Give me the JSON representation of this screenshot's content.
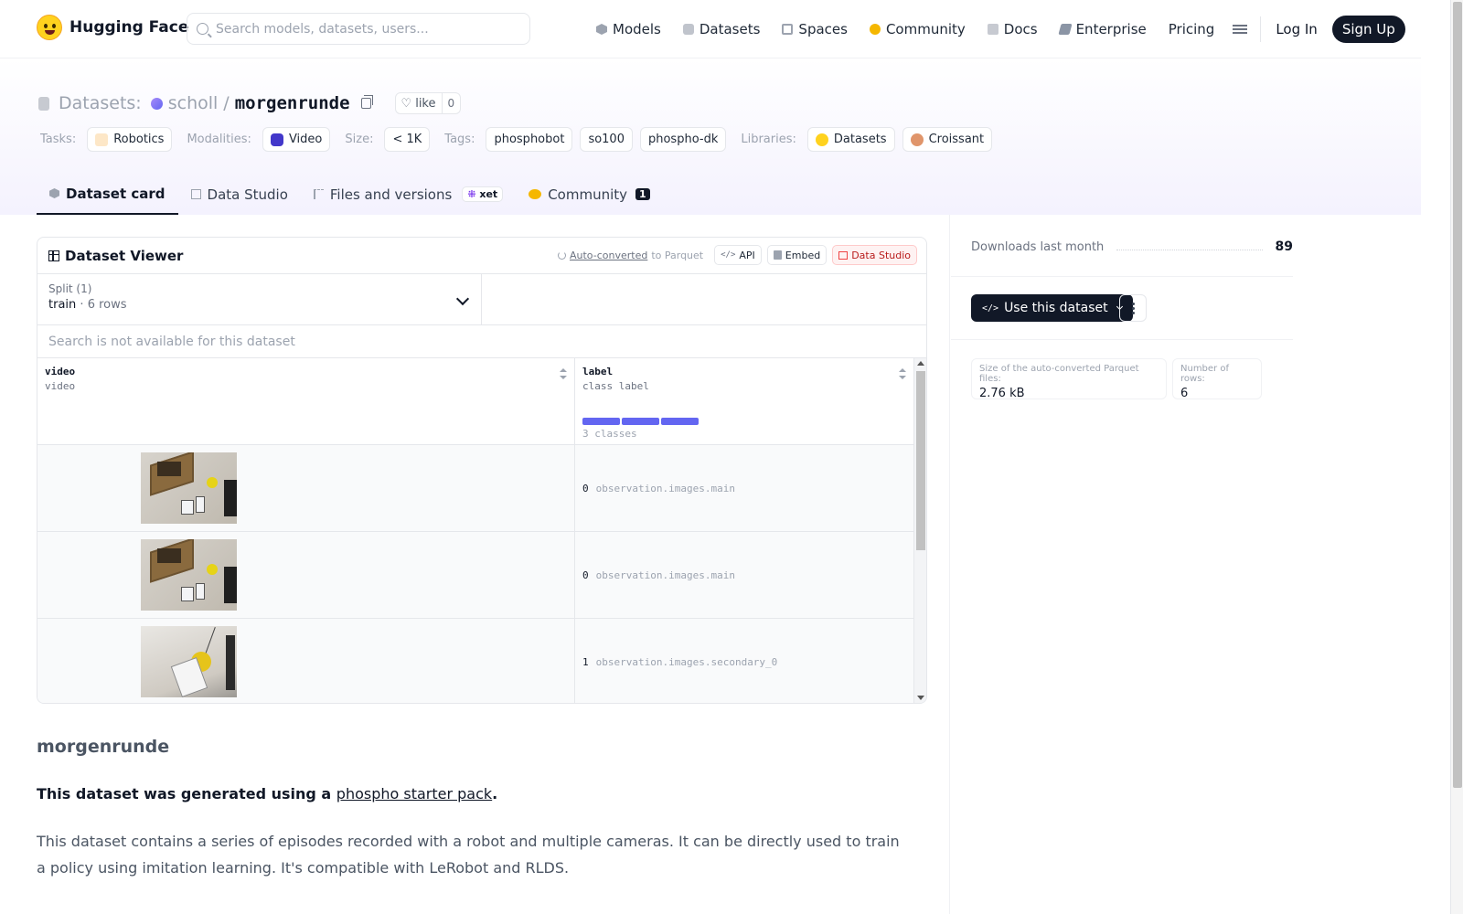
{
  "brand": {
    "name": "Hugging Face"
  },
  "search": {
    "placeholder": "Search models, datasets, users..."
  },
  "nav": {
    "items": [
      {
        "label": "Models",
        "icon": "models-icon"
      },
      {
        "label": "Datasets",
        "icon": "datasets-icon"
      },
      {
        "label": "Spaces",
        "icon": "spaces-icon"
      },
      {
        "label": "Community",
        "icon": "community-icon"
      },
      {
        "label": "Docs",
        "icon": "docs-icon"
      },
      {
        "label": "Enterprise",
        "icon": "enterprise-icon"
      },
      {
        "label": "Pricing",
        "icon": ""
      }
    ],
    "login": "Log In",
    "signup": "Sign Up"
  },
  "repo": {
    "type_label": "Datasets:",
    "owner": "scholl",
    "separator": "/",
    "name": "morgenrunde",
    "like_label": "like",
    "like_count": "0"
  },
  "tags": {
    "tasks_label": "Tasks:",
    "tasks": [
      "Robotics"
    ],
    "modalities_label": "Modalities:",
    "modalities": [
      "Video"
    ],
    "size_label": "Size:",
    "size": [
      "< 1K"
    ],
    "tags_label": "Tags:",
    "tags": [
      "phosphobot",
      "so100",
      "phospho-dk"
    ],
    "libraries_label": "Libraries:",
    "libraries": [
      "Datasets",
      "Croissant"
    ]
  },
  "tabs": [
    {
      "label": "Dataset card",
      "active": true
    },
    {
      "label": "Data Studio",
      "active": false
    },
    {
      "label": "Files and versions",
      "active": false,
      "badge": "xet"
    },
    {
      "label": "Community",
      "active": false,
      "count": "1"
    }
  ],
  "viewer": {
    "title": "Dataset Viewer",
    "autoconverted_prefix": "Auto-converted",
    "autoconverted_suffix": "to Parquet",
    "api_label": "API",
    "embed_label": "Embed",
    "studio_label": "Data Studio",
    "split_label": "Split (1)",
    "split_value": "train",
    "split_dot": "·",
    "split_rows": "6 rows",
    "search_na": "Search is not available for this dataset",
    "columns": [
      {
        "name": "video",
        "type": "video"
      },
      {
        "name": "label",
        "type": "class label",
        "classes_text": "3 classes"
      }
    ],
    "rows": [
      {
        "label_num": "0",
        "label_class": "observation.images.main"
      },
      {
        "label_num": "0",
        "label_class": "observation.images.main"
      },
      {
        "label_num": "1",
        "label_class": "observation.images.secondary_0"
      }
    ]
  },
  "card": {
    "heading": "morgenrunde",
    "p1_prefix": "This dataset was generated using a ",
    "p1_link": "phospho starter pack",
    "p1_suffix": ".",
    "p2": "This dataset contains a series of episodes recorded with a robot and multiple cameras. It can be directly used to train a policy using imitation learning. It's compatible with LeRobot and RLDS."
  },
  "sidebar": {
    "downloads_label": "Downloads last month",
    "downloads_value": "89",
    "use_button": "Use this dataset",
    "parquet_size_label": "Size of the auto-converted Parquet files:",
    "parquet_size_value": "2.76 kB",
    "num_rows_label": "Number of rows:",
    "num_rows_value": "6"
  },
  "colors": {
    "accent": "#6366f1",
    "dark": "#111827",
    "studio_red": "#ef4444"
  }
}
